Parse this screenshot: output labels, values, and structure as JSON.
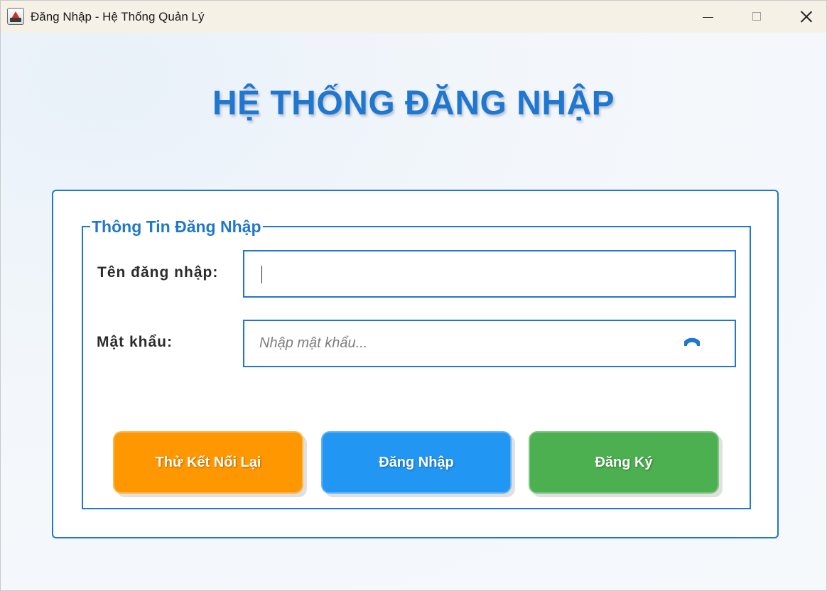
{
  "window": {
    "title": "Đăng Nhập - Hệ Thống Quản Lý"
  },
  "heading": "HỆ THỐNG ĐĂNG NHẬP",
  "login_group": {
    "legend": "Thông Tin Đăng Nhập",
    "username": {
      "label": "Tên đăng nhập:",
      "value": "",
      "placeholder": ""
    },
    "password": {
      "label": "Mật khẩu:",
      "value": "",
      "placeholder": "Nhập mật khẩu...",
      "toggle_icon": "eye-icon"
    }
  },
  "buttons": {
    "retry": "Thử Kết Nối Lại",
    "login": "Đăng Nhập",
    "register": "Đăng Ký"
  },
  "colors": {
    "accent": "#1f77cf",
    "retry": "#ff9800",
    "login": "#2196f3",
    "register": "#4caf50"
  }
}
